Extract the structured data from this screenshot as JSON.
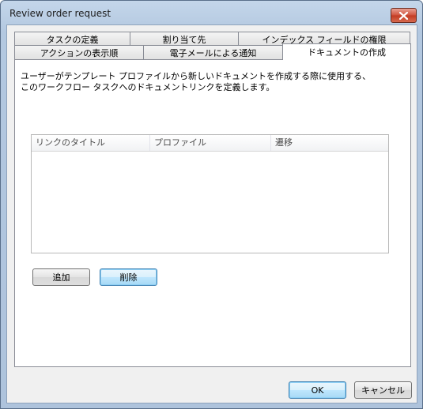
{
  "window": {
    "title": "Review order request"
  },
  "tabs_row1": [
    {
      "label": "タスクの定義"
    },
    {
      "label": "割り当て先"
    },
    {
      "label": "インデックス フィールドの権限"
    }
  ],
  "tabs_row2": [
    {
      "label": "アクションの表示順"
    },
    {
      "label": "電子メールによる通知"
    },
    {
      "label": "ドキュメントの作成"
    }
  ],
  "panel": {
    "description_line1": "ユーザーがテンプレート プロファイルから新しいドキュメントを作成する際に使用する、",
    "description_line2": "このワークフロー タスクへのドキュメントリンクを定義します。",
    "columns": [
      "リンクのタイトル",
      "プロファイル",
      "遷移"
    ],
    "add_label": "追加",
    "delete_label": "削除"
  },
  "footer": {
    "ok_label": "OK",
    "cancel_label": "キャンセル"
  }
}
